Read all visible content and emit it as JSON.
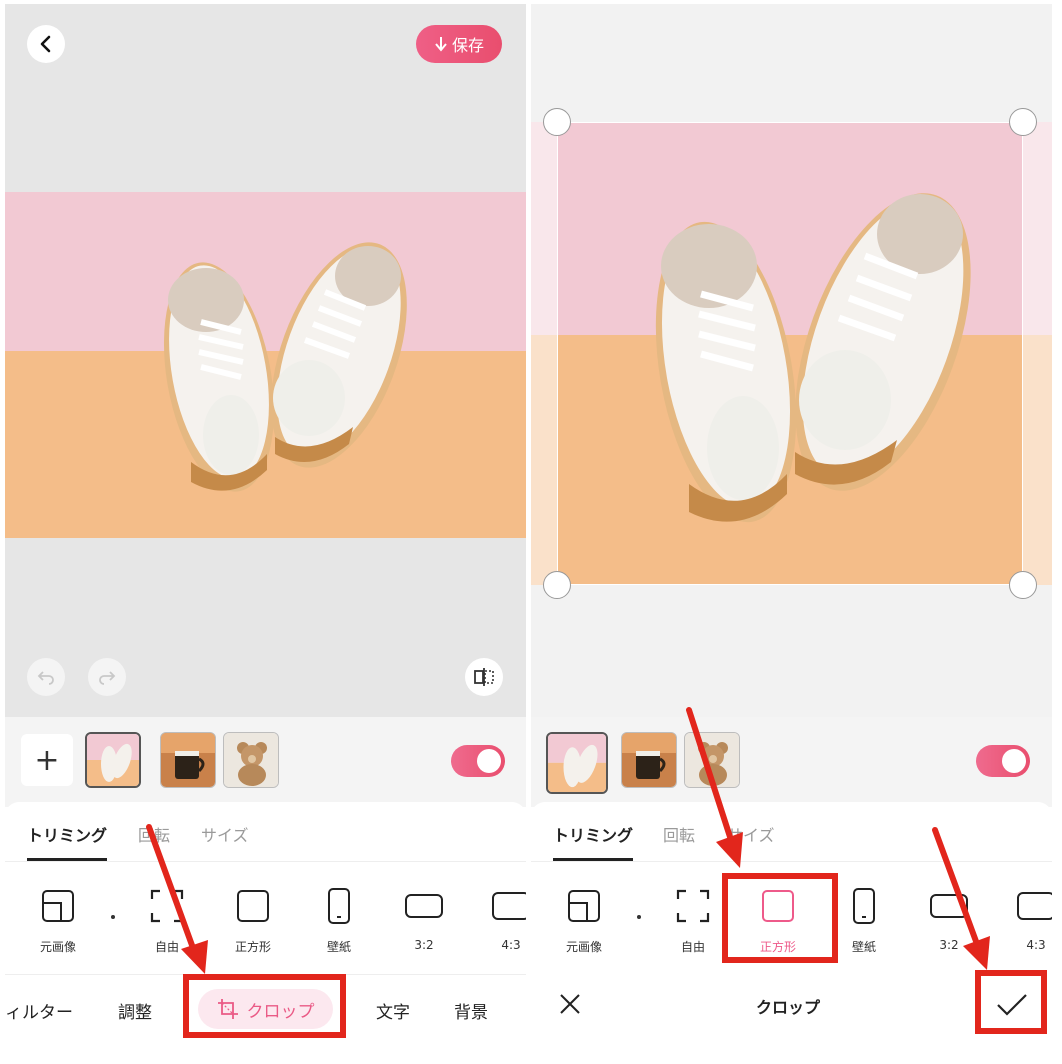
{
  "left": {
    "save_label": "保存",
    "thumbnails": [
      "shoes",
      "mug",
      "teddy-bear"
    ],
    "tabs": [
      "トリミング",
      "回転",
      "サイズ"
    ],
    "crop_options": [
      "元画像",
      "自由",
      "正方形",
      "壁紙",
      "3:2",
      "4:3"
    ],
    "nav": [
      "ィルター",
      "調整",
      "クロップ",
      "文字",
      "背景"
    ],
    "toggle_on": true
  },
  "right": {
    "tabs": [
      "トリミング",
      "回転",
      "サイズ"
    ],
    "crop_options": [
      "元画像",
      "自由",
      "正方形",
      "壁紙",
      "3:2",
      "4:3"
    ],
    "selected_option": "正方形",
    "title": "クロップ",
    "toggle_on": true
  },
  "colors": {
    "accent": "#ea5a86",
    "annotation": "#e2261c",
    "pink_bg": "#f2c9d3",
    "peach_bg": "#f4bd89"
  },
  "icons": [
    "back-icon",
    "download-icon",
    "undo-icon",
    "redo-icon",
    "compare-icon",
    "plus-icon",
    "close-icon",
    "check-icon",
    "crop-icon"
  ]
}
